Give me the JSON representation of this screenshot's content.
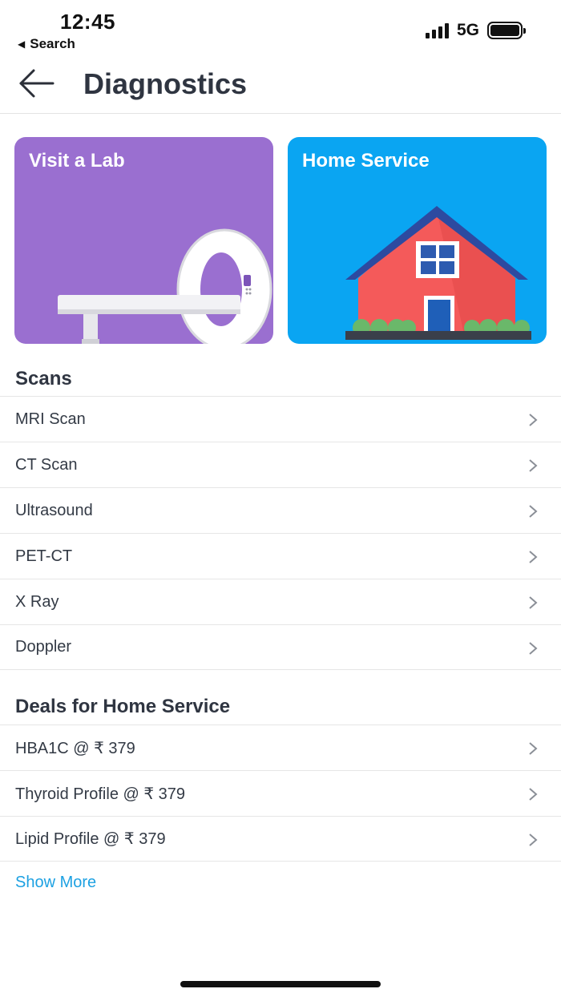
{
  "status_bar": {
    "time": "12:45",
    "back_label": "Search",
    "back_icon": "◀",
    "network": "5G"
  },
  "header": {
    "title": "Diagnostics"
  },
  "cards": {
    "lab": {
      "title": "Visit a Lab",
      "color": "#9a6fd0"
    },
    "home": {
      "title": "Home Service",
      "color": "#0aa5f2"
    }
  },
  "scans": {
    "title": "Scans",
    "items": [
      {
        "label": "MRI Scan"
      },
      {
        "label": "CT Scan"
      },
      {
        "label": "Ultrasound"
      },
      {
        "label": "PET-CT"
      },
      {
        "label": "X Ray"
      },
      {
        "label": "Doppler"
      }
    ]
  },
  "deals": {
    "title": "Deals for Home Service",
    "items": [
      {
        "label": "HBA1C @ ₹ 379"
      },
      {
        "label": "Thyroid Profile @ ₹ 379"
      },
      {
        "label": "Lipid Profile @ ₹ 379"
      }
    ],
    "show_more": "Show More"
  },
  "colors": {
    "link": "#1da1e2",
    "text": "#2f3541"
  }
}
